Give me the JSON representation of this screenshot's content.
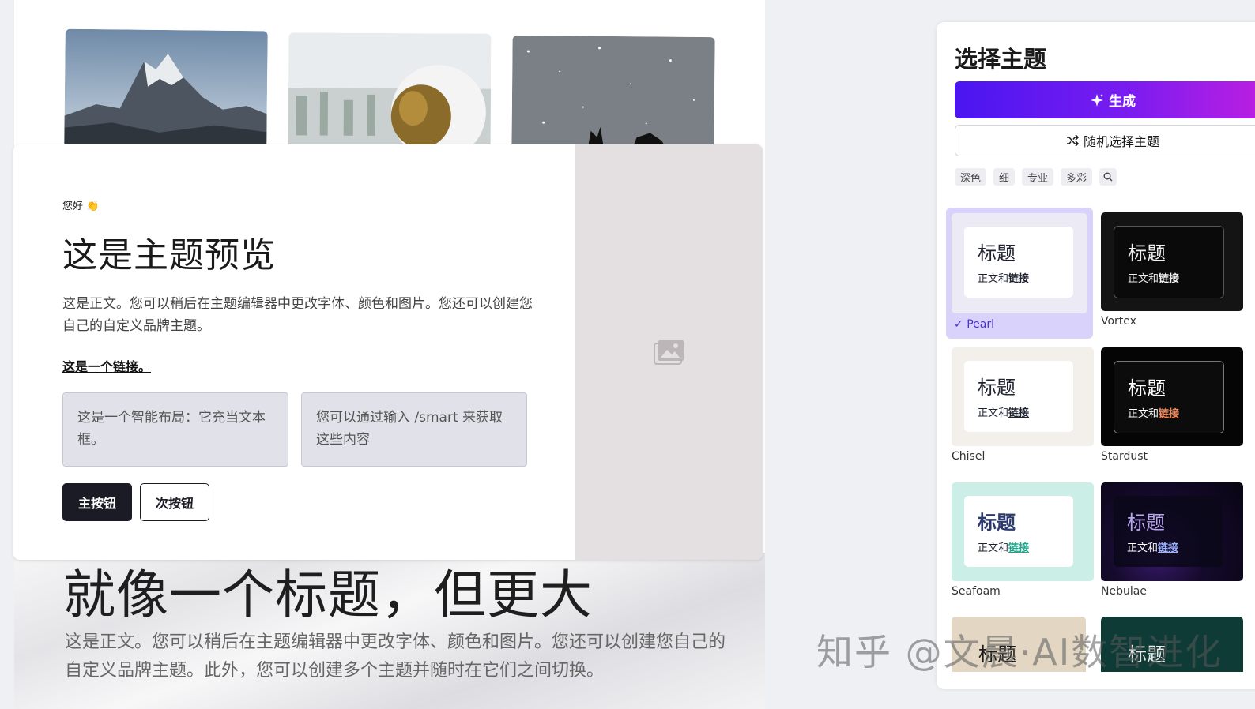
{
  "preview": {
    "greeting": "您好 👏",
    "title": "这是主题预览",
    "body": "这是正文。您可以稍后在主题编辑器中更改字体、颜色和图片。您还可以创建您自己的自定义品牌主题。",
    "link": "这是一个链接。",
    "smart_box_1": "这是一个智能布局：它充当文本框。",
    "smart_box_2": "您可以通过输入 /smart 来获取这些内容",
    "primary_button": "主按钮",
    "secondary_button": "次按钮",
    "image_placeholder_icon": "image-icon"
  },
  "background": {
    "heading": "就像一个标题，但更大",
    "body": "这是正文。您可以稍后在主题编辑器中更改字体、颜色和图片。您还可以创建您自己的自定义品牌主题。此外，您可以创建多个主题并随时在它们之间切换。"
  },
  "panel": {
    "title": "选择主题",
    "generate_label": "生成",
    "generate_icon": "sparkle-icon",
    "random_label": "随机选择主题",
    "random_icon": "shuffle-icon",
    "filters": [
      "深色",
      "细",
      "专业",
      "多彩"
    ],
    "search_icon": "search-icon",
    "selected_theme": "Pearl",
    "themes": [
      {
        "name": "Pearl",
        "title": "标题",
        "body": "正文和",
        "link": "链接"
      },
      {
        "name": "Vortex",
        "title": "标题",
        "body": "正文和",
        "link": "链接"
      },
      {
        "name": "Chisel",
        "title": "标题",
        "body": "正文和",
        "link": "链接"
      },
      {
        "name": "Stardust",
        "title": "标题",
        "body": "正文和",
        "link": "链接"
      },
      {
        "name": "Seafoam",
        "title": "标题",
        "body": "正文和",
        "link": "链接"
      },
      {
        "name": "Nebulae",
        "title": "标题",
        "body": "正文和",
        "link": "链接"
      }
    ],
    "partial_themes": [
      {
        "title": "标题"
      },
      {
        "title": "标题"
      }
    ]
  },
  "watermark": "知乎 @文晨·AI数智进化",
  "colors": {
    "generate_gradient_start": "#4a16f0",
    "generate_gradient_end": "#c01fe0",
    "selected_theme_bg": "#d9d2fb",
    "primary_button": "#1b1b26"
  }
}
